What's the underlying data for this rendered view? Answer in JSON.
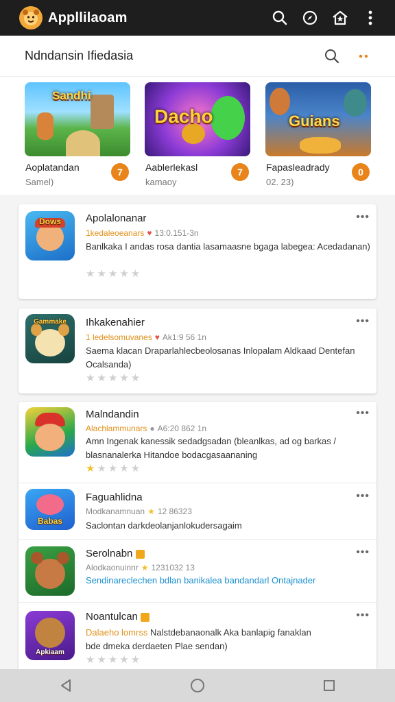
{
  "app": {
    "title": "Appllilaoam"
  },
  "subheader": {
    "title": "Ndndansin Ifiedasia"
  },
  "featured": [
    {
      "thumb_text": "Sandhi",
      "title": "Aoplatandan",
      "subtitle": "Samel)",
      "action": "7"
    },
    {
      "thumb_text": "Dacho",
      "title": "Aablerlekasl",
      "subtitle": "kamaoy",
      "action": "7"
    },
    {
      "thumb_text": "Guians",
      "title": "Fapasleadrady",
      "subtitle": "02. 23)",
      "action": "0"
    }
  ],
  "list": [
    {
      "icon_text": "Dows",
      "title": "Apolalonanar",
      "developer": "1kedaleoeanars",
      "stat": "13:0.151-3n",
      "description": "Banlkaka I andas rosa dantia lasamaasne bgaga labegea: Acedadanan)",
      "rating": 0
    },
    {
      "icon_text": "Gammake",
      "title": "Ihkakenahier",
      "developer": "1 ledelsomuvanes",
      "stat": "Ak1:9 56 1n",
      "description": "Saema klacan Draparlahlecbeolosanas Inlopalam Aldkaad Dentefan Ocalsanda)",
      "rating": 0
    },
    {
      "icon_text": "",
      "title": "Malndandin",
      "developer": "Alachlammunars",
      "stat": "A6:20 862 1n",
      "description": "Amn Ingenak kanessik sedadgsadan (bleanlkas, ad og barkas / blasnanalerka Hitandoe bodacgasaananing",
      "rating": 1
    },
    {
      "icon_text": "Babas",
      "title": "Faguahlidna",
      "developer": "Modkanamnuan",
      "stat": "12 86323",
      "description": "Saclontan darkdeolanjanlokudersagaim",
      "rating": null
    },
    {
      "icon_text": "",
      "title": "Serolnabn",
      "developer": "Alodkaonuinnr",
      "stat": "1231032 13",
      "description": "Sendinareclechen bdlan banikalea bandandarl Ontajnader",
      "rating": null
    },
    {
      "icon_text": "Apkiaam",
      "title": "Noantulcan",
      "developer": "Dalaeho lomrss",
      "stat": "Nalstdebanaonalk Aka banlapig fanaklan",
      "description": "bde dmeka derdaeten Plae sendan)",
      "rating": 0
    }
  ],
  "colors": {
    "accent": "#e8841a",
    "link": "#1a8fd0",
    "appbar": "#1e1e1e",
    "star": "#f0c12a"
  }
}
